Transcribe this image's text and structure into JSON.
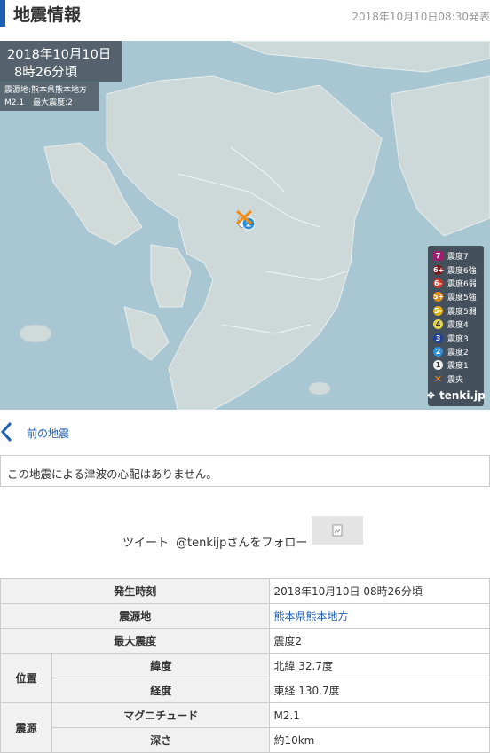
{
  "header": {
    "title": "地震情報",
    "datetime": "2018年10月10日08:30発表"
  },
  "map": {
    "date_line1": "2018年10月10日",
    "date_line2": "8時26分頃",
    "epicenter_line": "震源地:熊本県熊本地方",
    "magnitude_short": "M2.1",
    "max_intensity_short": "最大震度:2",
    "epicenter_marker_intensity": "2",
    "brand": "tenki.jp",
    "legend": [
      {
        "badge": "7",
        "label": "震度7",
        "color": "#9b1f6e"
      },
      {
        "badge": "6+",
        "label": "震度6強",
        "color": "#7a1a1a"
      },
      {
        "badge": "6-",
        "label": "震度6弱",
        "color": "#c0392b"
      },
      {
        "badge": "5+",
        "label": "震度5強",
        "color": "#e08a1e"
      },
      {
        "badge": "5-",
        "label": "震度5弱",
        "color": "#e3b01b"
      },
      {
        "badge": "4",
        "label": "震度4",
        "color": "#e6d84a"
      },
      {
        "badge": "3",
        "label": "震度3",
        "color": "#1f3f9c"
      },
      {
        "badge": "2",
        "label": "震度2",
        "color": "#2e8fd8"
      },
      {
        "badge": "1",
        "label": "震度1",
        "color": "#f0f0f0"
      },
      {
        "badge": "✕",
        "label": "震央",
        "color": "#f08a10"
      }
    ]
  },
  "nav": {
    "prev_label": "前の地震"
  },
  "tsunami": {
    "message": "この地震による津波の心配はありません。"
  },
  "social": {
    "tweet": "ツイート",
    "follow": "@tenkijpさんをフォロー"
  },
  "table": {
    "occurred_header": "発生時刻",
    "occurred_value": "2018年10月10日 08時26分頃",
    "epicenter_header": "震源地",
    "epicenter_value": "熊本県熊本地方",
    "max_intensity_header": "最大震度",
    "max_intensity_value": "震度2",
    "position_header": "位置",
    "latitude_header": "緯度",
    "latitude_value": "北緯 32.7度",
    "longitude_header": "経度",
    "longitude_value": "東経 130.7度",
    "source_header": "震源",
    "magnitude_header": "マグニチュード",
    "magnitude_value": "M2.1",
    "depth_header": "深さ",
    "depth_value": "約10km"
  }
}
